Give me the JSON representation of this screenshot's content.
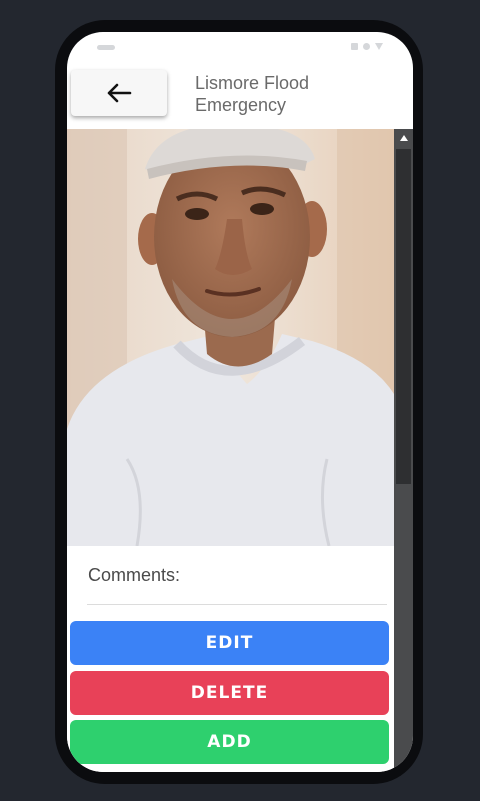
{
  "header": {
    "back_icon": "arrow-left-icon",
    "title": "Lismore Flood Emergency"
  },
  "status_icons": [
    "pill-indicator",
    "square-icon",
    "circle-icon",
    "triangle-icon"
  ],
  "photo": {
    "subject": "man-in-white-cap-and-t-shirt"
  },
  "comments": {
    "label": "Comments:"
  },
  "buttons": {
    "edit": "EDIT",
    "delete": "DELETE",
    "add": "ADD"
  },
  "colors": {
    "edit": "#3b82f6",
    "delete": "#e84158",
    "add": "#2ed06e",
    "background": "#23272f"
  }
}
